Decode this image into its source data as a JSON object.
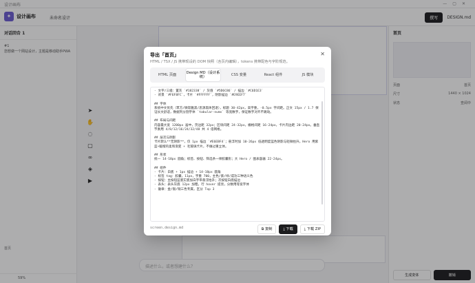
{
  "app": {
    "window_title": "设计画布",
    "brand": "设计画布",
    "breadcrumb": [
      "未命名设计"
    ],
    "conversation_label": "对话回合",
    "conversation_count": "1",
    "conversation_item_num": "#1",
    "conversation_item_text": "您想做一个网站设计，主题是移动助手PWA",
    "left_bottom_text": "首页",
    "zoom": "59%",
    "top_btn_primary": "撰写",
    "file_name_top": "DESIGN.md",
    "chat_placeholder": "描述什么，或者想建什么？",
    "right_title": "首页",
    "right_rows": [
      {
        "k": "页面",
        "v": "首页"
      },
      {
        "k": "尺寸",
        "v": "1440 × 1024"
      },
      {
        "k": "状态",
        "v": "查阅中"
      }
    ],
    "right_foot_btn1": "生成变体",
    "right_foot_btn2": "撤销"
  },
  "modal": {
    "title": "导出「首页」",
    "subtitle": "HTML / TSX / JS 携带现设的 DOM 快照（含页内编辑），tokens 携带配色与字阶规范。",
    "tabs": [
      {
        "label": "HTML 页面",
        "active": false
      },
      {
        "label": "Design MD（设计系统）",
        "active": true
      },
      {
        "label": "CSS 变量",
        "active": false
      },
      {
        "label": "React 组件",
        "active": false
      },
      {
        "label": "JS 模块",
        "active": false
      }
    ],
    "code": "- 文字/三级：置灰 `#182338` / 灰值 `#5D6C86` / 描边 `#C6D1E3`\n- 背景 `#F6F8FC`，卡片 `#FFFFFF`，阴影描边 `#E9EEF7`\n\n## 字体\n系统中文优先（苹方/微软雅黑/思源黑体回退），标题 30-42px，高字重，-0.5px 字间距。正文 15px / 1.7 保证长文舒适，数据列分割字体 `tabular-nums` 等宽数字，保证数字对齐不跳动。\n\n## 布局与间距\n内容最大宽 1200px 居中，页边距 32px；区块间距 24-32px，栅格间距 16-24px，卡片内边距 20-24px。垂直节奏用 4/8/12/16/24/32/48 共 4 倍网格。\n\n## 层次与阴影\n卡片默认**无阴影**，仅 1px 描边 `#E6EBF4`；悬浮时加 10-26px 低透明度蓝色阴影与轻微抬升。Hero 用紫蓝+暖橙的柔和渐变 + 毛玻璃卡片，不做过重立体。\n\n## 形状\n统一 14-18px 圆角；标签、按钮、筛选条一律胶囊形；大 Hero / 图表容器 22-24px。\n\n## 组件\n- 卡片：白底 + 1px 描边 + 14-18px 圆角\n- 标签 tag：胶囊，11px，字重 700，主色/紫/绿/成功三种语义色\n- 按钮：主按钮蓝底实底加白字带悬浮抬升；次按钮白底描边\n- 表头：表头灰底 12px 加粗，行 hover 提亮，分数用等宽字体\n- 徽章：金/银/铜三色专属，区分 Top 3",
    "filename": "screen.design.md",
    "btn_copy": "复制",
    "btn_download": "下载",
    "btn_download_zip": "下载 ZIP",
    "close_glyph": "✕"
  }
}
